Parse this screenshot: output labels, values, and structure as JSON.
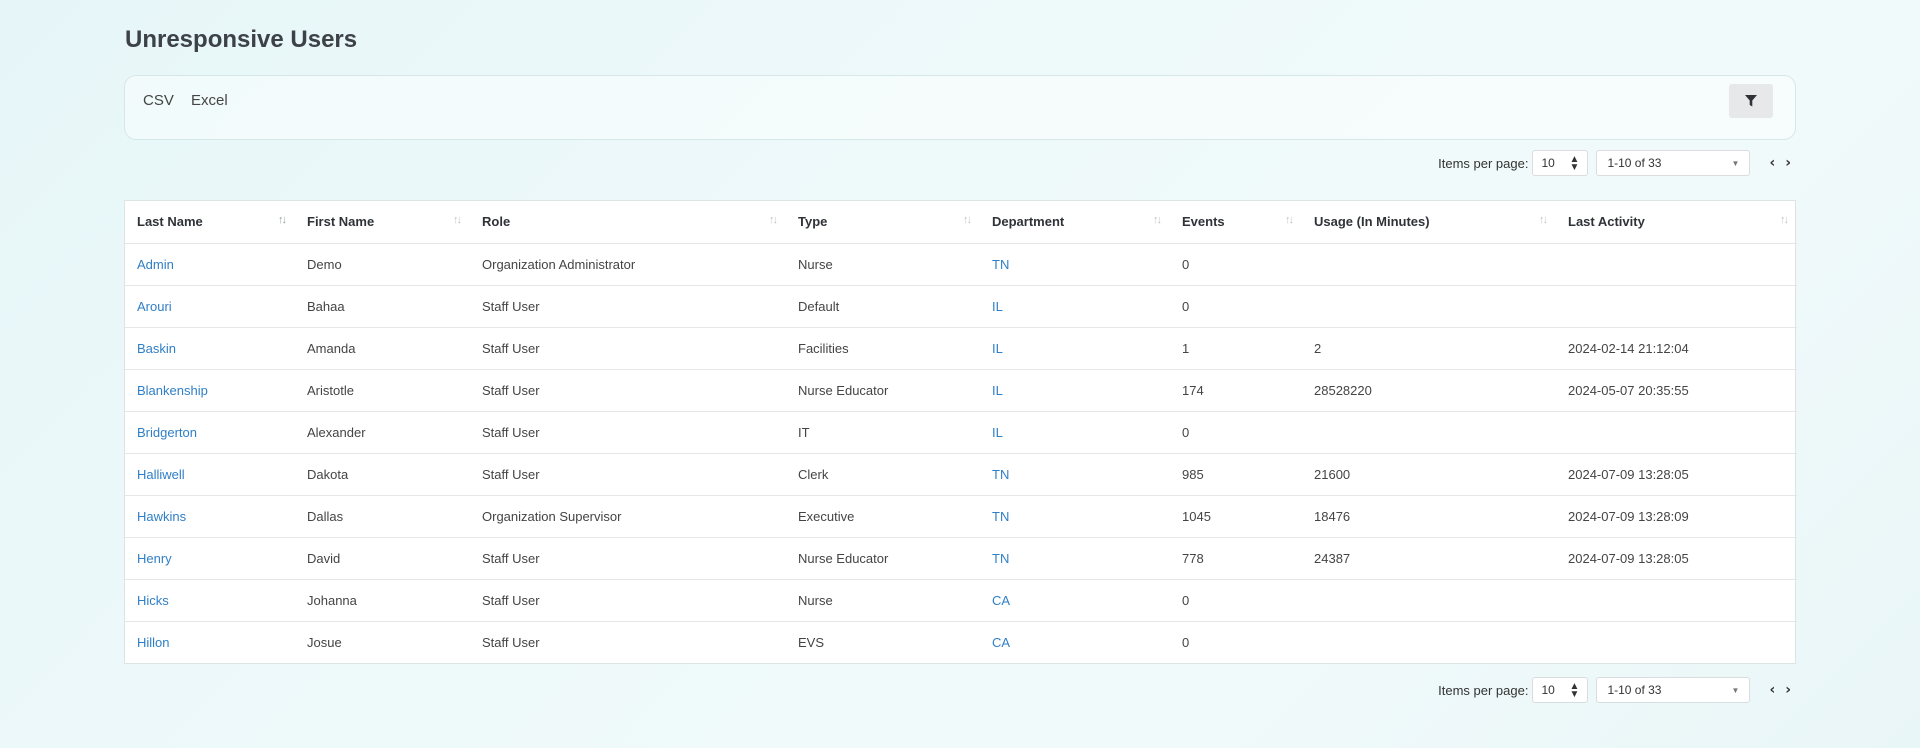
{
  "page": {
    "title": "Unresponsive Users"
  },
  "toolbar": {
    "csv_label": "CSV",
    "excel_label": "Excel",
    "filter_icon": "filter-icon"
  },
  "pager": {
    "items_per_page_label": "Items per page:",
    "items_per_page": "10",
    "range": "1-10 of 33"
  },
  "table": {
    "columns": [
      "Last Name",
      "First Name",
      "Role",
      "Type",
      "Department",
      "Events",
      "Usage (In Minutes)",
      "Last Activity"
    ],
    "rows": [
      {
        "last_name": "Admin",
        "first_name": "Demo",
        "role": "Organization Administrator",
        "type": "Nurse",
        "department": "TN",
        "events": "0",
        "usage": "",
        "last_activity": ""
      },
      {
        "last_name": "Arouri",
        "first_name": "Bahaa",
        "role": "Staff User",
        "type": "Default",
        "department": "IL",
        "events": "0",
        "usage": "",
        "last_activity": ""
      },
      {
        "last_name": "Baskin",
        "first_name": "Amanda",
        "role": "Staff User",
        "type": "Facilities",
        "department": "IL",
        "events": "1",
        "usage": "2",
        "last_activity": "2024-02-14 21:12:04"
      },
      {
        "last_name": "Blankenship",
        "first_name": "Aristotle",
        "role": "Staff User",
        "type": "Nurse Educator",
        "department": "IL",
        "events": "174",
        "usage": "28528220",
        "last_activity": "2024-05-07 20:35:55"
      },
      {
        "last_name": "Bridgerton",
        "first_name": "Alexander",
        "role": "Staff User",
        "type": "IT",
        "department": "IL",
        "events": "0",
        "usage": "",
        "last_activity": ""
      },
      {
        "last_name": "Halliwell",
        "first_name": "Dakota",
        "role": "Staff User",
        "type": "Clerk",
        "department": "TN",
        "events": "985",
        "usage": "21600",
        "last_activity": "2024-07-09 13:28:05"
      },
      {
        "last_name": "Hawkins",
        "first_name": "Dallas",
        "role": "Organization Supervisor",
        "type": "Executive",
        "department": "TN",
        "events": "1045",
        "usage": "18476",
        "last_activity": "2024-07-09 13:28:09"
      },
      {
        "last_name": "Henry",
        "first_name": "David",
        "role": "Staff User",
        "type": "Nurse Educator",
        "department": "TN",
        "events": "778",
        "usage": "24387",
        "last_activity": "2024-07-09 13:28:05"
      },
      {
        "last_name": "Hicks",
        "first_name": "Johanna",
        "role": "Staff User",
        "type": "Nurse",
        "department": "CA",
        "events": "0",
        "usage": "",
        "last_activity": ""
      },
      {
        "last_name": "Hillon",
        "first_name": "Josue",
        "role": "Staff User",
        "type": "EVS",
        "department": "CA",
        "events": "0",
        "usage": "",
        "last_activity": ""
      }
    ]
  }
}
